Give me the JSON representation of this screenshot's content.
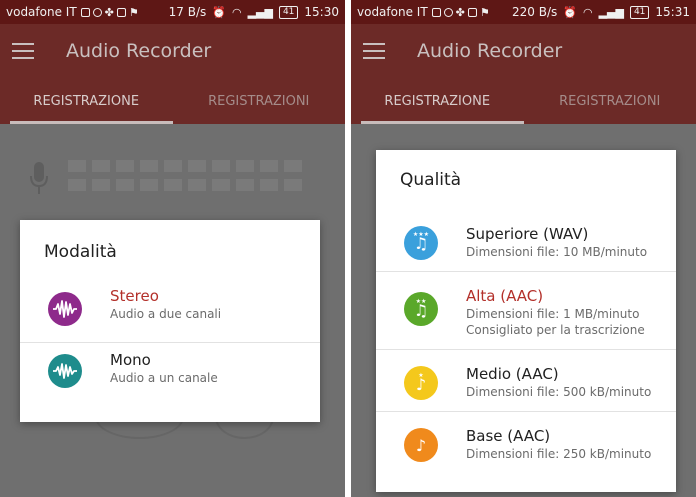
{
  "left": {
    "status_bar": {
      "carrier": "vodafone IT",
      "speed": "17 B/s",
      "battery": "41",
      "time": "15:30"
    },
    "app_bar": {
      "title": "Audio Recorder",
      "menu_icon": "hamburger-menu-icon"
    },
    "tabs": [
      {
        "label": "REGISTRAZIONE",
        "active": true
      },
      {
        "label": "REGISTRAZIONI",
        "active": false
      }
    ],
    "dialog": {
      "title": "Modalità",
      "options": [
        {
          "title": "Stereo",
          "subtitle": "Audio a due canali",
          "selected": true,
          "icon": "waveform-icon",
          "icon_color": "#8e2a8b"
        },
        {
          "title": "Mono",
          "subtitle": "Audio a un canale",
          "selected": false,
          "icon": "waveform-icon",
          "icon_color": "#1e8c8c"
        }
      ]
    }
  },
  "right": {
    "status_bar": {
      "carrier": "vodafone IT",
      "speed": "220 B/s",
      "battery": "41",
      "time": "15:31"
    },
    "app_bar": {
      "title": "Audio Recorder",
      "menu_icon": "hamburger-menu-icon"
    },
    "tabs": [
      {
        "label": "REGISTRAZIONE",
        "active": true
      },
      {
        "label": "REGISTRAZIONI",
        "active": false
      }
    ],
    "dialog": {
      "title": "Qualità",
      "options": [
        {
          "title": "Superiore (WAV)",
          "line1": "Dimensioni file: 10 MB/minuto",
          "line2": "",
          "selected": false,
          "icon": "music-note-icon",
          "icon_color": "#3aa0dc"
        },
        {
          "title": "Alta (AAC)",
          "line1": "Dimensioni file: 1 MB/minuto",
          "line2": "Consigliato per la trascrizione",
          "selected": true,
          "icon": "music-note-icon",
          "icon_color": "#5aa82a"
        },
        {
          "title": "Medio (AAC)",
          "line1": "Dimensioni file: 500 kB/minuto",
          "line2": "",
          "selected": false,
          "icon": "music-note-icon",
          "icon_color": "#f4c81c"
        },
        {
          "title": "Base (AAC)",
          "line1": "Dimensioni file: 250 kB/minuto",
          "line2": "",
          "selected": false,
          "icon": "music-note-icon",
          "icon_color": "#f08a1c"
        }
      ]
    }
  }
}
